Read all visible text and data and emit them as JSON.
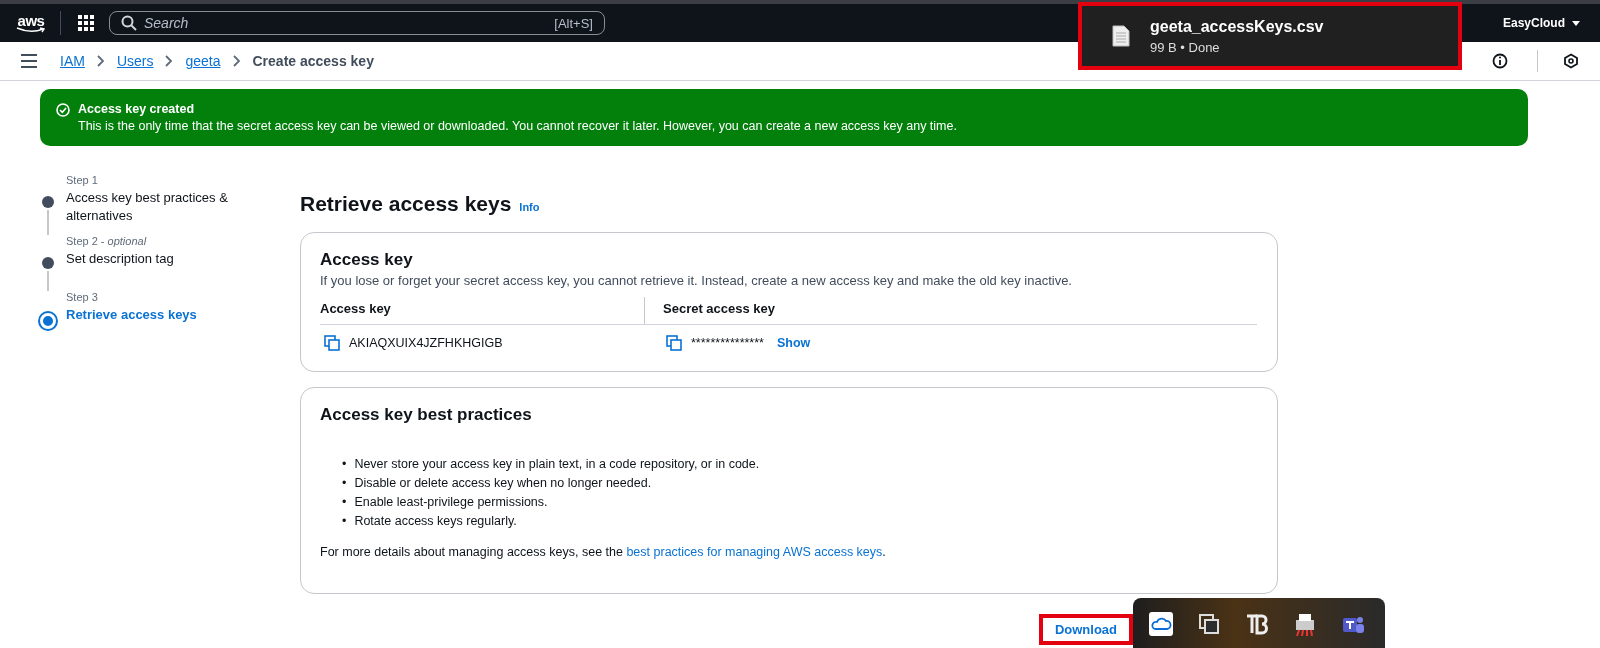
{
  "top_nav": {
    "logo": "aws",
    "search": {
      "placeholder": "Search",
      "shortcut": "[Alt+S]"
    },
    "account": "EasyCloud"
  },
  "breadcrumbs": [
    {
      "label": "IAM",
      "link": true
    },
    {
      "label": "Users",
      "link": true
    },
    {
      "label": "geeta",
      "link": true
    },
    {
      "label": "Create access key",
      "link": false
    }
  ],
  "download_popup": {
    "file_name": "geeta_accessKeys.csv",
    "status": "99 B • Done"
  },
  "flash": {
    "title": "Access key created",
    "message": "This is the only time that the secret access key can be viewed or downloaded. You cannot recover it later. However, you can create a new access key any time."
  },
  "steps": [
    {
      "step": "Step 1",
      "title": "Access key best practices & alternatives",
      "selected": false
    },
    {
      "step": "Step 2 - ",
      "note": "optional",
      "title": "Set description tag",
      "selected": false
    },
    {
      "step": "Step 3",
      "title": "Retrieve access keys",
      "selected": true
    }
  ],
  "page_title": "Retrieve access keys",
  "info_link": "Info",
  "access_key_panel": {
    "title": "Access key",
    "description": "If you lose or forget your secret access key, you cannot retrieve it. Instead, create a new access key and make the old key inactive.",
    "columns": [
      "Access key",
      "Secret access key"
    ],
    "access_key": "AKIAQXUIX4JZFHKHGIGB",
    "secret_masked": "***************",
    "show_link": "Show"
  },
  "best_practices_panel": {
    "title": "Access key best practices",
    "bullet": "•",
    "items": [
      "Never store your access key in plain text, in a code repository, or in code.",
      "Disable or delete access key when no longer needed.",
      "Enable least-privilege permissions.",
      "Rotate access keys regularly."
    ],
    "footer_text": "For more details about managing access keys, see the ",
    "footer_link": "best practices for managing AWS access keys",
    "footer_end": "."
  },
  "download_button": "Download"
}
